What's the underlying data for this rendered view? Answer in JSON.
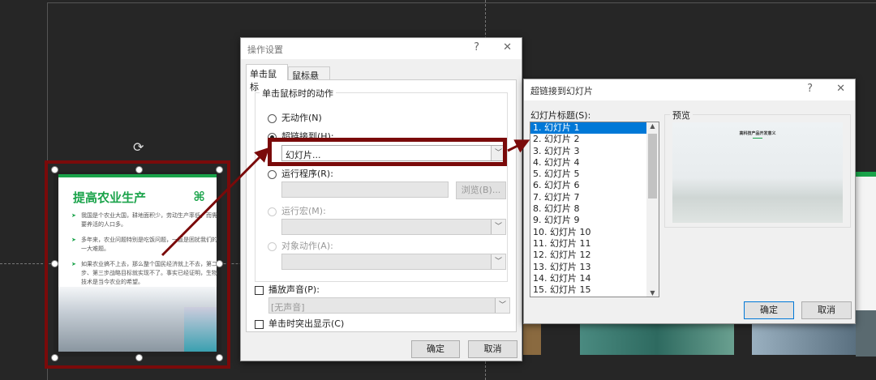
{
  "slide": {
    "title": "提高农业生产",
    "bullets": [
      "我国是个农业大国，耕地面积少，劳动生产率低，而需要养活的人口多。",
      "多年来，农业问题特别是吃饭问题，一直是困扰我们的一大难题。",
      "如果农业搞不上去，那么整个国民经济就上不去，第二步、第三步战略目标就实现不了。事实已经证明，生物技术是当今农业的希望。"
    ],
    "accent": "#1aa34a"
  },
  "action_dialog": {
    "title": "操作设置",
    "help": "?",
    "close": "✕",
    "tabs": [
      "单击鼠标",
      "鼠标悬停"
    ],
    "group_label": "单击鼠标时的动作",
    "none": "无动作(N)",
    "hyperlink": "超链接到(H):",
    "hyperlink_value": "幻灯片...",
    "run_program": "运行程序(R):",
    "browse": "浏览(B)...",
    "run_macro": "运行宏(M):",
    "object_action": "对象动作(A):",
    "play_sound": "播放声音(P):",
    "sound_value": "[无声音]",
    "highlight": "单击时突出显示(C)",
    "ok": "确定",
    "cancel": "取消"
  },
  "link_dialog": {
    "title": "超链接到幻灯片",
    "help": "?",
    "close": "✕",
    "list_label": "幻灯片标题(S):",
    "preview_label": "预览",
    "preview_title": "高科技产品开发意义",
    "slides": [
      "1. 幻灯片 1",
      "2. 幻灯片 2",
      "3. 幻灯片 3",
      "4. 幻灯片 4",
      "5. 幻灯片 5",
      "6. 幻灯片 6",
      "7. 幻灯片 7",
      "8. 幻灯片 8",
      "9. 幻灯片 9",
      "10. 幻灯片 10",
      "11. 幻灯片 11",
      "12. 幻灯片 12",
      "13. 幻灯片 13",
      "14. 幻灯片 14",
      "15. 幻灯片 15"
    ],
    "ok": "确定",
    "cancel": "取消"
  },
  "colors": {
    "highlight": "#7a0a0a",
    "selection": "#0078d7"
  }
}
